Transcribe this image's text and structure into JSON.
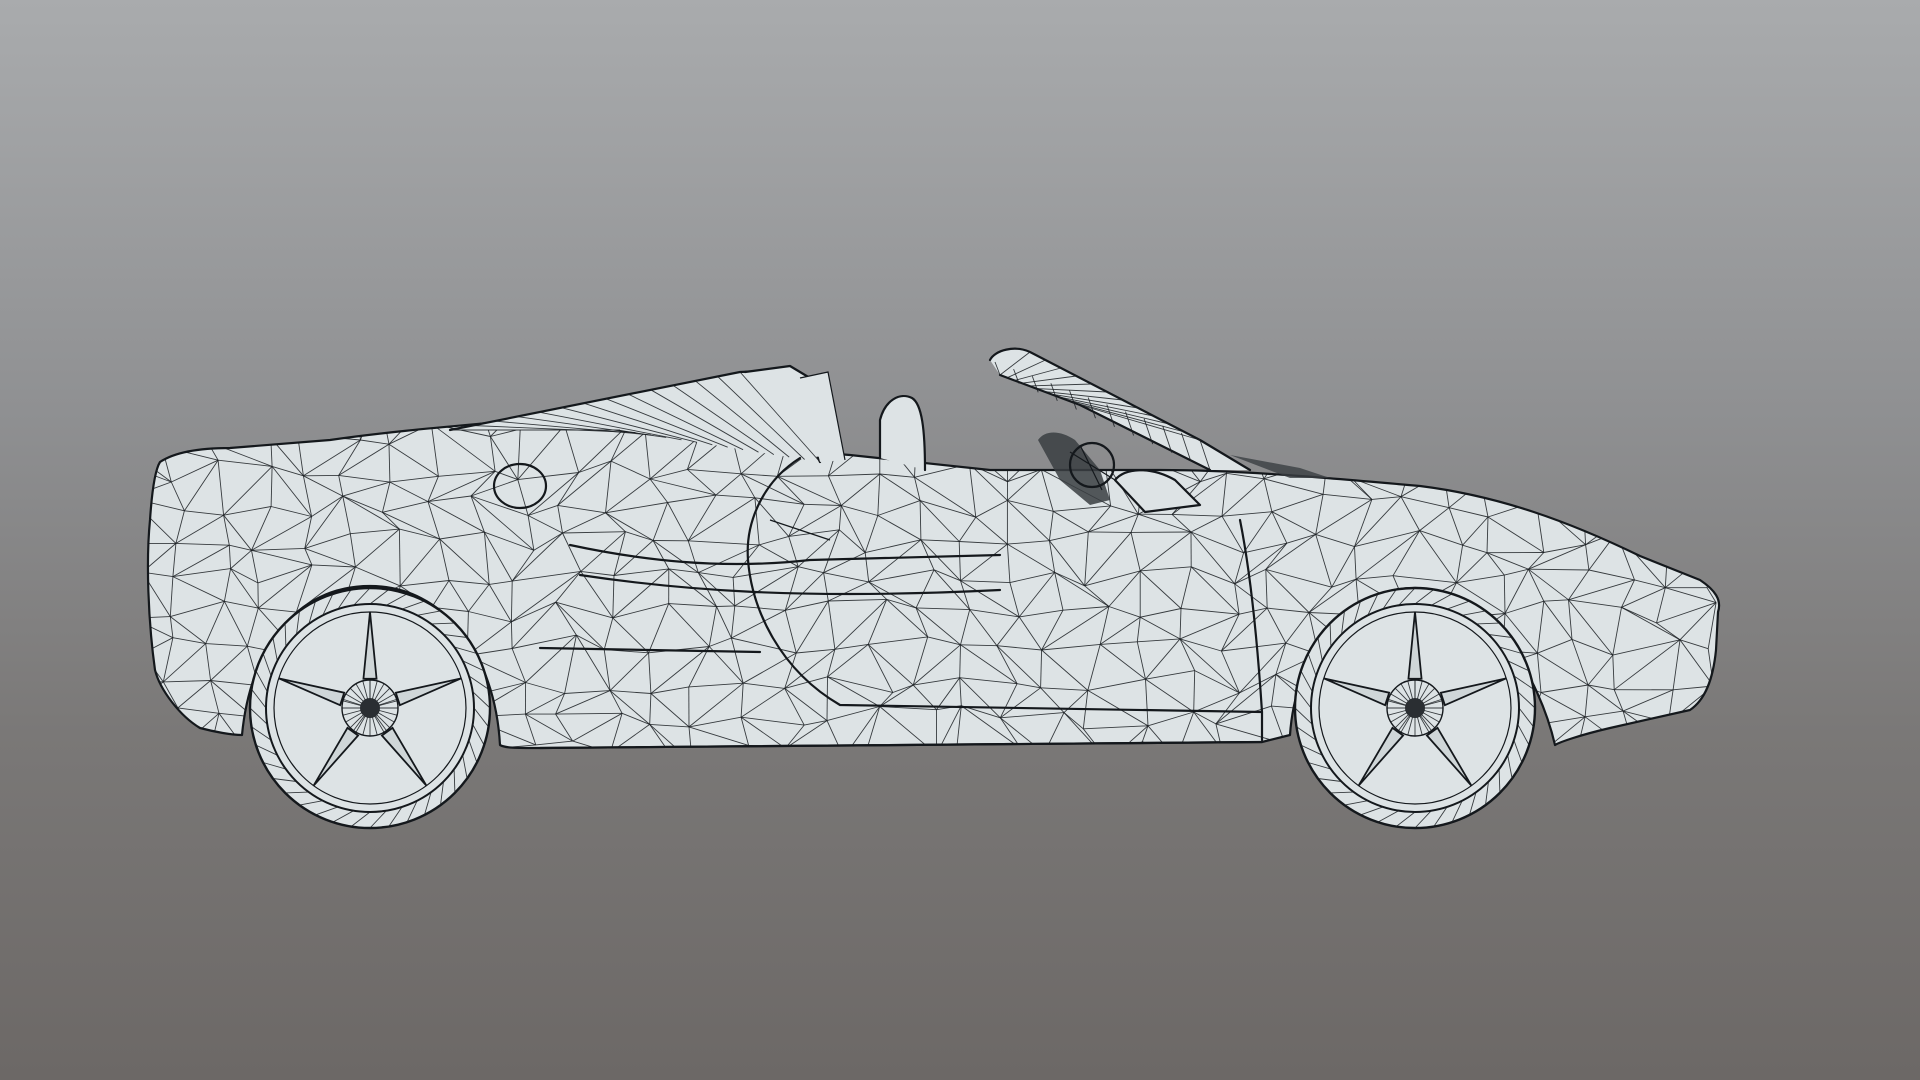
{
  "scene": {
    "background_top": "#a9abad",
    "background_bottom": "#6c6866",
    "mesh_fill": "#dde3e5",
    "wire_color": "#14181c"
  }
}
